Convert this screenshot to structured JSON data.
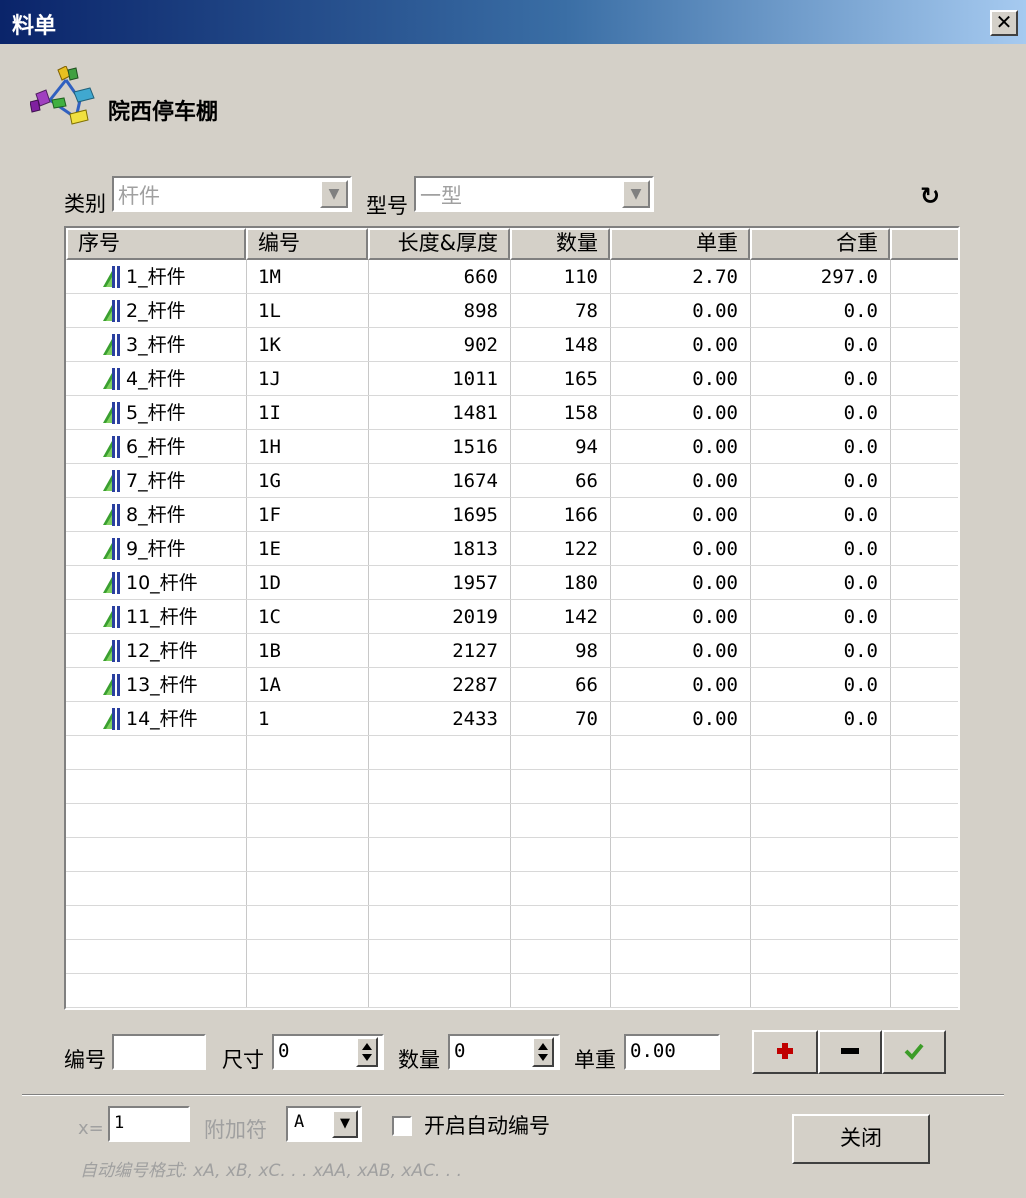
{
  "window": {
    "title": "料单",
    "close_label": "✕"
  },
  "header": {
    "title": "院西停车棚"
  },
  "filter": {
    "category_label": "类别",
    "category_value": "杆件",
    "model_label": "型号",
    "model_value": "一型"
  },
  "table": {
    "columns": [
      "序号",
      "编号",
      "长度&厚度",
      "数量",
      "单重",
      "合重"
    ],
    "rows": [
      {
        "seq": "1_杆件",
        "code": "1M",
        "length": "660",
        "qty": "110",
        "unit_weight": "2.70",
        "total_weight": "297.0"
      },
      {
        "seq": "2_杆件",
        "code": "1L",
        "length": "898",
        "qty": "78",
        "unit_weight": "0.00",
        "total_weight": "0.0"
      },
      {
        "seq": "3_杆件",
        "code": "1K",
        "length": "902",
        "qty": "148",
        "unit_weight": "0.00",
        "total_weight": "0.0"
      },
      {
        "seq": "4_杆件",
        "code": "1J",
        "length": "1011",
        "qty": "165",
        "unit_weight": "0.00",
        "total_weight": "0.0"
      },
      {
        "seq": "5_杆件",
        "code": "1I",
        "length": "1481",
        "qty": "158",
        "unit_weight": "0.00",
        "total_weight": "0.0"
      },
      {
        "seq": "6_杆件",
        "code": "1H",
        "length": "1516",
        "qty": "94",
        "unit_weight": "0.00",
        "total_weight": "0.0"
      },
      {
        "seq": "7_杆件",
        "code": "1G",
        "length": "1674",
        "qty": "66",
        "unit_weight": "0.00",
        "total_weight": "0.0"
      },
      {
        "seq": "8_杆件",
        "code": "1F",
        "length": "1695",
        "qty": "166",
        "unit_weight": "0.00",
        "total_weight": "0.0"
      },
      {
        "seq": "9_杆件",
        "code": "1E",
        "length": "1813",
        "qty": "122",
        "unit_weight": "0.00",
        "total_weight": "0.0"
      },
      {
        "seq": "10_杆件",
        "code": "1D",
        "length": "1957",
        "qty": "180",
        "unit_weight": "0.00",
        "total_weight": "0.0"
      },
      {
        "seq": "11_杆件",
        "code": "1C",
        "length": "2019",
        "qty": "142",
        "unit_weight": "0.00",
        "total_weight": "0.0"
      },
      {
        "seq": "12_杆件",
        "code": "1B",
        "length": "2127",
        "qty": "98",
        "unit_weight": "0.00",
        "total_weight": "0.0"
      },
      {
        "seq": "13_杆件",
        "code": "1A",
        "length": "2287",
        "qty": "66",
        "unit_weight": "0.00",
        "total_weight": "0.0"
      },
      {
        "seq": "14_杆件",
        "code": "1",
        "length": "2433",
        "qty": "70",
        "unit_weight": "0.00",
        "total_weight": "0.0"
      }
    ]
  },
  "editor": {
    "code_label": "编号",
    "code_value": "",
    "size_label": "尺寸",
    "size_value": "0",
    "qty_label": "数量",
    "qty_value": "0",
    "weight_label": "单重",
    "weight_value": "0.00",
    "add_icon": "plus-icon",
    "remove_icon": "minus-icon",
    "confirm_icon": "check-icon"
  },
  "autonum": {
    "x_label": "x=",
    "x_value": "1",
    "suffix_label": "附加符",
    "suffix_value": "A",
    "checkbox_label": "开启自动编号",
    "checked": false,
    "format_hint": "自动编号格式: xA, xB, xC. . . xAA, xAB, xAC. . ."
  },
  "footer": {
    "close_label": "关闭"
  },
  "colors": {
    "add": "#c00000",
    "confirm": "#3c9c28",
    "titlebar": "#0a246a"
  }
}
